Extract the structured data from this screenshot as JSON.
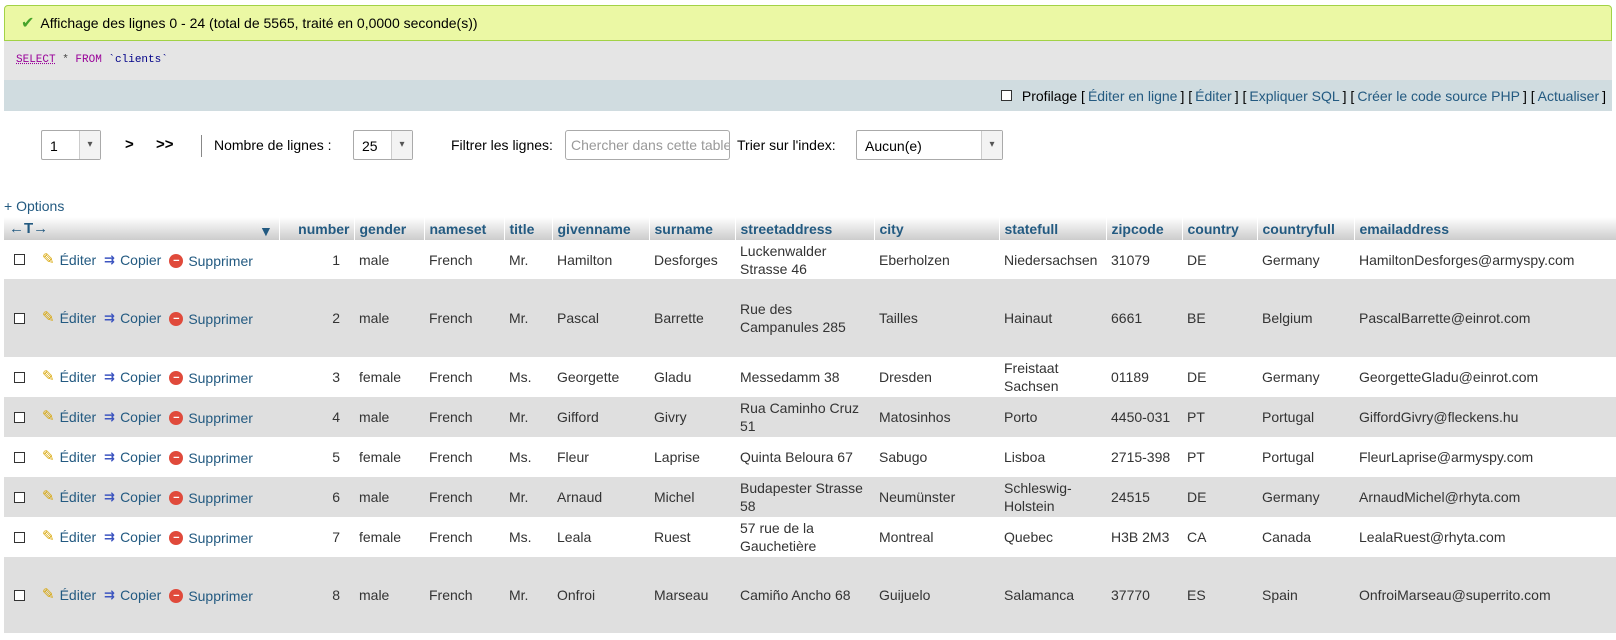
{
  "message": {
    "icon": "check-icon",
    "text": "Affichage des lignes 0 - 24 (total de 5565, traité en 0,0000 seconde(s))"
  },
  "sql": {
    "select": "SELECT",
    "star": " * ",
    "from": "FROM",
    "table": " `clients`"
  },
  "toolbar": {
    "profiling_label": "Profilage",
    "links": [
      "Éditer en ligne",
      "Éditer",
      "Expliquer SQL",
      "Créer le code source PHP",
      "Actualiser"
    ]
  },
  "nav": {
    "page_value": "1",
    "next": ">",
    "last": ">>",
    "rows_label": "Nombre de lignes :",
    "rows_value": "25",
    "filter_label": "Filtrer les lignes:",
    "filter_placeholder": "Chercher dans cette table",
    "sort_label": "Trier sur l'index:",
    "sort_value": "Aucun(e)"
  },
  "options_label": "+ Options",
  "table": {
    "columns": [
      "number",
      "gender",
      "nameset",
      "title",
      "givenname",
      "surname",
      "streetaddress",
      "city",
      "statefull",
      "zipcode",
      "country",
      "countryfull",
      "emailaddress"
    ],
    "actions": {
      "edit": "Éditer",
      "copy": "Copier",
      "delete": "Supprimer"
    },
    "rows": [
      [
        "1",
        "male",
        "French",
        "Mr.",
        "Hamilton",
        "Desforges",
        "Luckenwalder Strasse 46",
        "Eberholzen",
        "Niedersachsen",
        "31079",
        "DE",
        "Germany",
        "HamiltonDesforges@armyspy.com"
      ],
      [
        "2",
        "male",
        "French",
        "Mr.",
        "Pascal",
        "Barrette",
        "Rue des Campanules 285",
        "Tailles",
        "Hainaut",
        "6661",
        "BE",
        "Belgium",
        "PascalBarrette@einrot.com"
      ],
      [
        "3",
        "female",
        "French",
        "Ms.",
        "Georgette",
        "Gladu",
        "Messedamm 38",
        "Dresden",
        "Freistaat Sachsen",
        "01189",
        "DE",
        "Germany",
        "GeorgetteGladu@einrot.com"
      ],
      [
        "4",
        "male",
        "French",
        "Mr.",
        "Gifford",
        "Givry",
        "Rua Caminho Cruz 51",
        "Matosinhos",
        "Porto",
        "4450-031",
        "PT",
        "Portugal",
        "GiffordGivry@fleckens.hu"
      ],
      [
        "5",
        "female",
        "French",
        "Ms.",
        "Fleur",
        "Laprise",
        "Quinta Beloura 67",
        "Sabugo",
        "Lisboa",
        "2715-398",
        "PT",
        "Portugal",
        "FleurLaprise@armyspy.com"
      ],
      [
        "6",
        "male",
        "French",
        "Mr.",
        "Arnaud",
        "Michel",
        "Budapester Strasse 58",
        "Neumünster",
        "Schleswig-Holstein",
        "24515",
        "DE",
        "Germany",
        "ArnaudMichel@rhyta.com"
      ],
      [
        "7",
        "female",
        "French",
        "Ms.",
        "Leala",
        "Ruest",
        "57 rue de la Gauchetière",
        "Montreal",
        "Quebec",
        "H3B 2M3",
        "CA",
        "Canada",
        "LealaRuest@rhyta.com"
      ],
      [
        "8",
        "male",
        "French",
        "Mr.",
        "Onfroi",
        "Marseau",
        "Camiño Ancho 68",
        "Guijuelo",
        "Salamanca",
        "37770",
        "ES",
        "Spain",
        "OnfroiMarseau@superrito.com"
      ]
    ]
  }
}
